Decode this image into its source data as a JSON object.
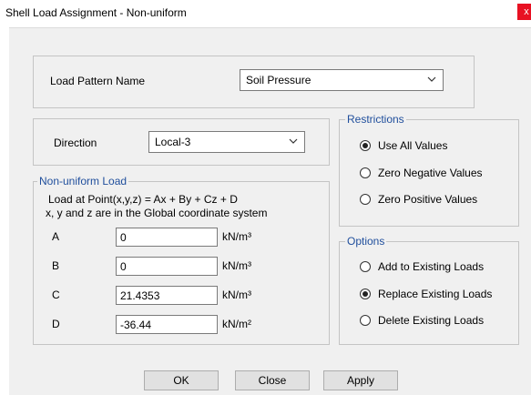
{
  "window": {
    "title": "Shell Load Assignment -  Non-uniform",
    "close_glyph": "x"
  },
  "load_pattern": {
    "label": "Load Pattern Name",
    "value": "Soil Pressure"
  },
  "direction": {
    "label": "Direction",
    "value": "Local-3"
  },
  "nonuniform": {
    "title": "Non-uniform Load",
    "formula": "Load at Point(x,y,z) = Ax + By + Cz + D",
    "note": "x, y and z are in the Global coordinate system",
    "rows": [
      {
        "label": "A",
        "value": "0",
        "unit": "kN/m³"
      },
      {
        "label": "B",
        "value": "0",
        "unit": "kN/m³"
      },
      {
        "label": "C",
        "value": "21.4353",
        "unit": "kN/m³"
      },
      {
        "label": "D",
        "value": "-36.44",
        "unit": "kN/m²"
      }
    ]
  },
  "restrictions": {
    "title": "Restrictions",
    "options": [
      {
        "label": "Use All Values",
        "selected": true
      },
      {
        "label": "Zero Negative Values",
        "selected": false
      },
      {
        "label": "Zero Positive Values",
        "selected": false
      }
    ]
  },
  "options": {
    "title": "Options",
    "options": [
      {
        "label": "Add to Existing Loads",
        "selected": false
      },
      {
        "label": "Replace Existing Loads",
        "selected": true
      },
      {
        "label": "Delete Existing Loads",
        "selected": false
      }
    ]
  },
  "buttons": {
    "ok": "OK",
    "close": "Close",
    "apply": "Apply"
  },
  "icons": {
    "dropdown": "chevron-down-icon"
  }
}
